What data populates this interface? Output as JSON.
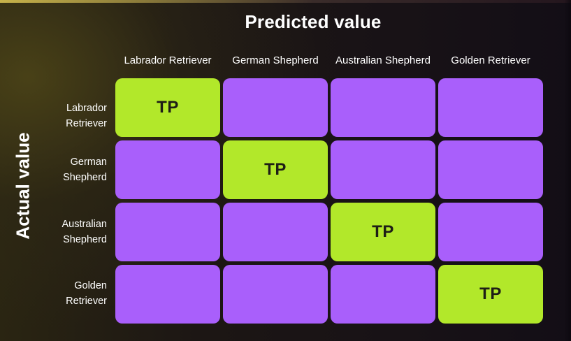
{
  "titles": {
    "predicted": "Predicted value",
    "actual": "Actual value"
  },
  "columns": [
    "Labrador Retriever",
    "German Shepherd",
    "Australian Shepherd",
    "Golden Retriever"
  ],
  "rows": [
    [
      "Labrador",
      "Retriever"
    ],
    [
      "German",
      "Shepherd"
    ],
    [
      "Australian",
      "Shepherd"
    ],
    [
      "Golden",
      "Retriever"
    ]
  ],
  "cells": [
    [
      "TP",
      "",
      "",
      ""
    ],
    [
      "",
      "TP",
      "",
      ""
    ],
    [
      "",
      "",
      "TP",
      ""
    ],
    [
      "",
      "",
      "",
      "TP"
    ]
  ],
  "colors": {
    "tp_cell": "#b2e82a",
    "other_cell": "#a95ffb"
  }
}
